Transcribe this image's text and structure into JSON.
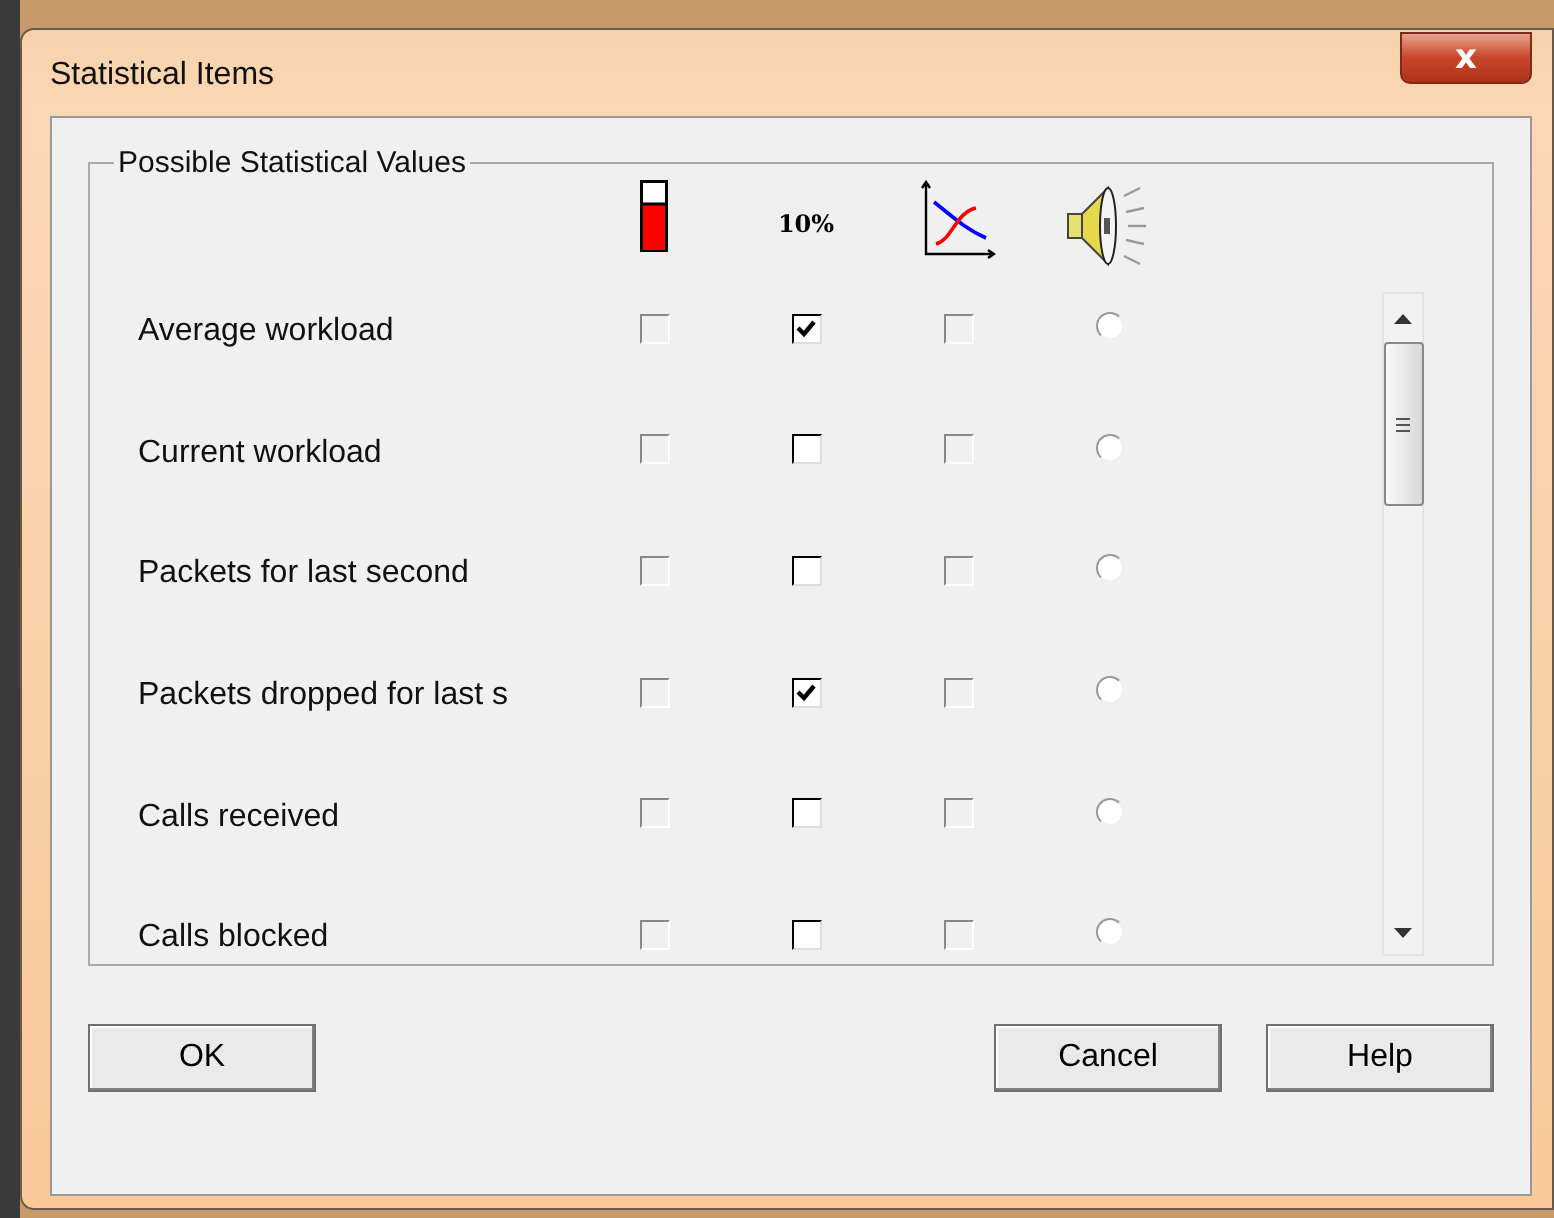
{
  "window": {
    "title": "Statistical Items",
    "close_label": "x"
  },
  "group": {
    "title": "Possible Statistical Values",
    "columns": [
      {
        "kind": "gauge"
      },
      {
        "kind": "text",
        "label": "10%"
      },
      {
        "kind": "graph"
      },
      {
        "kind": "speaker"
      }
    ],
    "rows": [
      {
        "label": "Average workload",
        "cells": [
          {
            "kind": "checkbox",
            "checked": false,
            "disabled": true
          },
          {
            "kind": "checkbox",
            "checked": true,
            "disabled": false
          },
          {
            "kind": "checkbox",
            "checked": false,
            "disabled": true
          },
          {
            "kind": "radio",
            "selected": false
          }
        ]
      },
      {
        "label": "Current workload",
        "cells": [
          {
            "kind": "checkbox",
            "checked": false,
            "disabled": true
          },
          {
            "kind": "checkbox",
            "checked": false,
            "disabled": false
          },
          {
            "kind": "checkbox",
            "checked": false,
            "disabled": true
          },
          {
            "kind": "radio",
            "selected": false
          }
        ]
      },
      {
        "label": "Packets for last second",
        "cells": [
          {
            "kind": "checkbox",
            "checked": false,
            "disabled": true
          },
          {
            "kind": "checkbox",
            "checked": false,
            "disabled": false
          },
          {
            "kind": "checkbox",
            "checked": false,
            "disabled": true
          },
          {
            "kind": "radio",
            "selected": false
          }
        ]
      },
      {
        "label": "Packets dropped for last s",
        "cells": [
          {
            "kind": "checkbox",
            "checked": false,
            "disabled": true
          },
          {
            "kind": "checkbox",
            "checked": true,
            "disabled": false
          },
          {
            "kind": "checkbox",
            "checked": false,
            "disabled": true
          },
          {
            "kind": "radio",
            "selected": false
          }
        ]
      },
      {
        "label": "Calls received",
        "cells": [
          {
            "kind": "checkbox",
            "checked": false,
            "disabled": true
          },
          {
            "kind": "checkbox",
            "checked": false,
            "disabled": false
          },
          {
            "kind": "checkbox",
            "checked": false,
            "disabled": true
          },
          {
            "kind": "radio",
            "selected": false
          }
        ]
      },
      {
        "label": "Calls blocked",
        "cells": [
          {
            "kind": "checkbox",
            "checked": false,
            "disabled": true
          },
          {
            "kind": "checkbox",
            "checked": false,
            "disabled": false
          },
          {
            "kind": "checkbox",
            "checked": false,
            "disabled": true
          },
          {
            "kind": "radio",
            "selected": false
          }
        ]
      }
    ]
  },
  "buttons": [
    "OK",
    "Cancel",
    "Help"
  ]
}
